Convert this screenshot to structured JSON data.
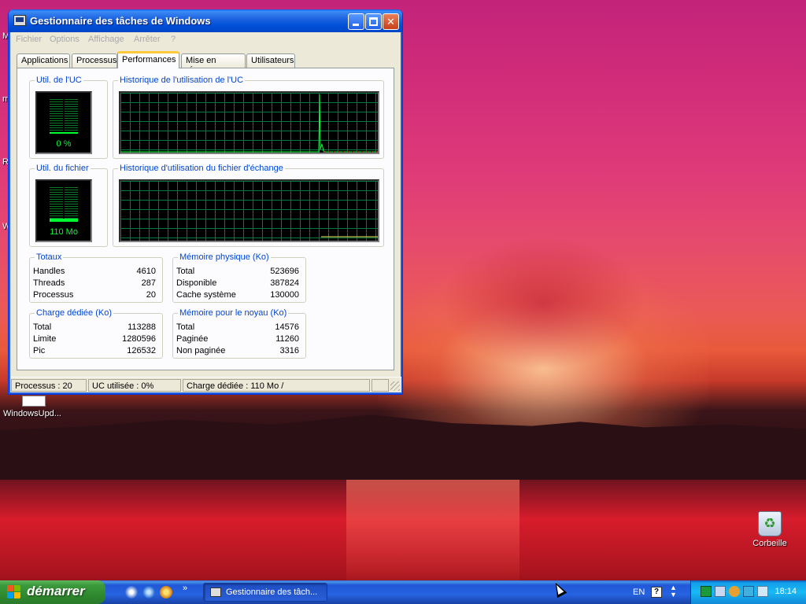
{
  "window": {
    "title": "Gestionnaire des tâches de Windows",
    "menu": [
      "Fichier",
      "Options",
      "Affichage",
      "Arrêter",
      "?"
    ],
    "tabs": [
      "Applications",
      "Processus",
      "Performances",
      "Mise en réseau",
      "Utilisateurs"
    ],
    "active_tab": "Performances"
  },
  "performance": {
    "cpu_usage_label": "Util. de l'UC",
    "cpu_usage_value": "0 %",
    "cpu_usage_level": 0.0,
    "cpu_history_label": "Historique de l'utilisation de l'UC",
    "pagefile_label": "Util. du fichier",
    "pagefile_value": "110 Mo",
    "pagefile_level": 0.1,
    "pagefile_history_label": "Historique d'utilisation du fichier d'échange"
  },
  "totals": {
    "label": "Totaux",
    "rows": [
      {
        "k": "Handles",
        "v": "4610"
      },
      {
        "k": "Threads",
        "v": "287"
      },
      {
        "k": "Processus",
        "v": "20"
      }
    ]
  },
  "physical_memory": {
    "label": "Mémoire physique (Ko)",
    "rows": [
      {
        "k": "Total",
        "v": "523696"
      },
      {
        "k": "Disponible",
        "v": "387824"
      },
      {
        "k": "Cache système",
        "v": "130000"
      }
    ]
  },
  "commit_charge": {
    "label": "Charge dédiée (Ko)",
    "rows": [
      {
        "k": "Total",
        "v": "113288"
      },
      {
        "k": "Limite",
        "v": "1280596"
      },
      {
        "k": "Pic",
        "v": "126532"
      }
    ]
  },
  "kernel_memory": {
    "label": "Mémoire pour le noyau (Ko)",
    "rows": [
      {
        "k": "Total",
        "v": "14576"
      },
      {
        "k": "Paginée",
        "v": "11260"
      },
      {
        "k": "Non paginée",
        "v": "3316"
      }
    ]
  },
  "statusbar": {
    "processes": "Processus : 20",
    "cpu": "UC utilisée : 0%",
    "commit": "Charge dédiée : 110 Mo /"
  },
  "desktop": {
    "recycle_bin": "Corbeille",
    "windows_update": "WindowsUpd..."
  },
  "taskbar": {
    "start_label": "démarrer",
    "task_button": "Gestionnaire des tâch...",
    "language": "EN",
    "clock": "18:14",
    "quicklaunch_overflow": "»"
  },
  "colors": {
    "xp_blue": "#0046d5",
    "graph_green": "#00ff33",
    "grid_green": "#0a7a3a",
    "start_green": "#3c9a3c"
  }
}
